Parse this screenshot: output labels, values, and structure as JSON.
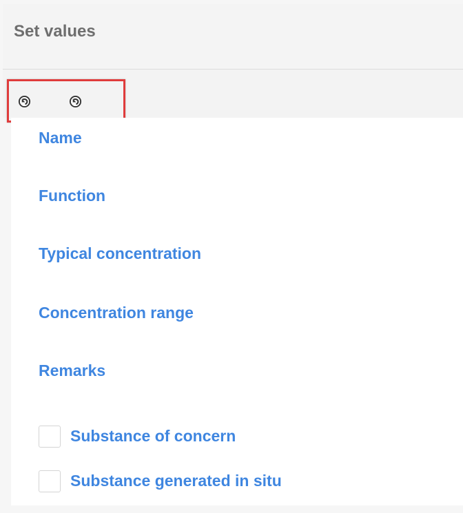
{
  "header": {
    "title": "Set values"
  },
  "toolbar": {
    "icons": [
      "revert-icon",
      "revert-icon"
    ]
  },
  "fields": {
    "name_label": "Name",
    "function_label": "Function",
    "typical_concentration_label": "Typical concentration",
    "concentration_range_label": "Concentration range",
    "remarks_label": "Remarks"
  },
  "checkboxes": {
    "substance_of_concern": {
      "label": "Substance of concern",
      "checked": false
    },
    "generated_in_situ": {
      "label": "Substance generated in situ",
      "checked": false
    }
  },
  "colors": {
    "link_blue": "#3f86e0",
    "highlight_red": "#e03c3c",
    "title_grey": "#6e6e6e"
  }
}
